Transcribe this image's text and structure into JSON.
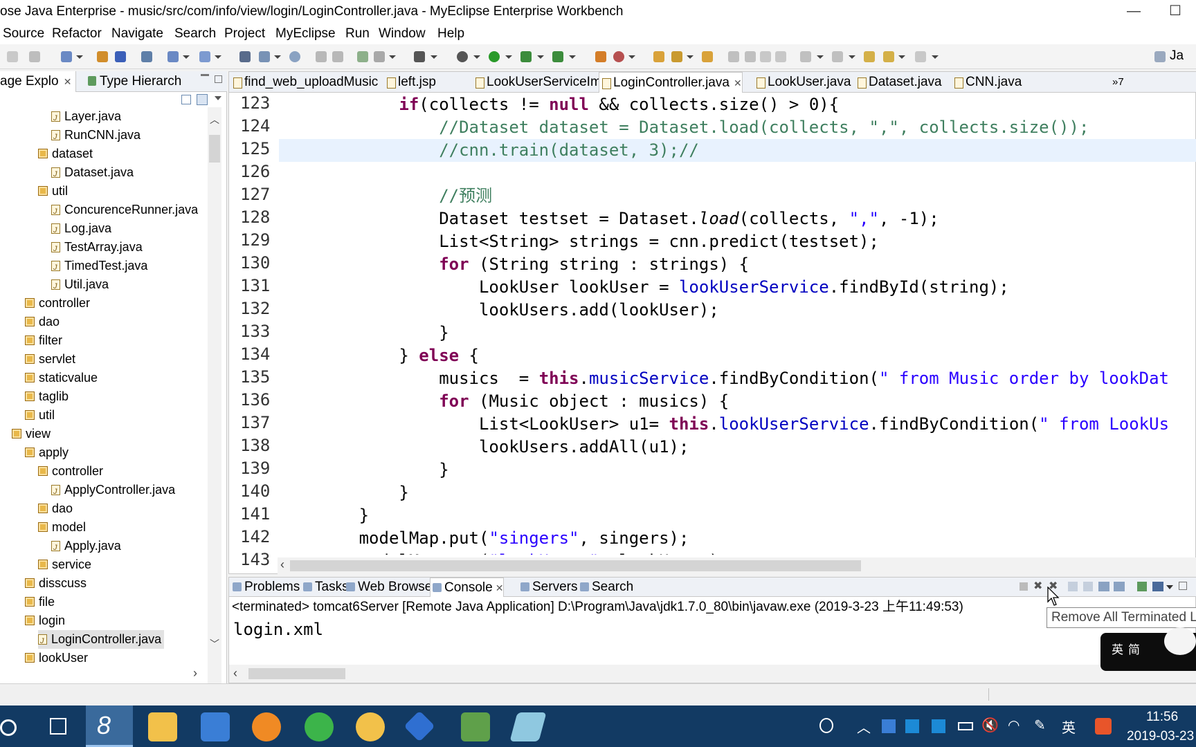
{
  "window": {
    "title": "ose Java Enterprise - music/src/com/info/view/login/LoginController.java - MyEclipse Enterprise Workbench",
    "minimize": "—",
    "maximize": "☐"
  },
  "menu": [
    "Source",
    "Refactor",
    "Navigate",
    "Search",
    "Project",
    "MyEclipse",
    "Run",
    "Window",
    "Help"
  ],
  "toolbar": {
    "perspective": "Ja"
  },
  "left_panel": {
    "tabs": [
      {
        "label": "age Explo",
        "close": "✕"
      },
      {
        "label": "Type Hierarch"
      }
    ],
    "tree": [
      {
        "label": "Layer.java",
        "type": "java",
        "indent": 4
      },
      {
        "label": "RunCNN.java",
        "type": "java",
        "indent": 4
      },
      {
        "label": "dataset",
        "type": "pkg",
        "indent": 3
      },
      {
        "label": "Dataset.java",
        "type": "java",
        "indent": 4
      },
      {
        "label": "util",
        "type": "pkg",
        "indent": 3
      },
      {
        "label": "ConcurenceRunner.java",
        "type": "java",
        "indent": 4
      },
      {
        "label": "Log.java",
        "type": "java",
        "indent": 4
      },
      {
        "label": "TestArray.java",
        "type": "java",
        "indent": 4
      },
      {
        "label": "TimedTest.java",
        "type": "java",
        "indent": 4
      },
      {
        "label": "Util.java",
        "type": "java",
        "indent": 4
      },
      {
        "label": "controller",
        "type": "pkg",
        "indent": 2
      },
      {
        "label": "dao",
        "type": "pkg",
        "indent": 2
      },
      {
        "label": "filter",
        "type": "pkg",
        "indent": 2
      },
      {
        "label": "servlet",
        "type": "pkg",
        "indent": 2
      },
      {
        "label": "staticvalue",
        "type": "pkg",
        "indent": 2
      },
      {
        "label": "taglib",
        "type": "pkg",
        "indent": 2
      },
      {
        "label": "util",
        "type": "pkg",
        "indent": 2
      },
      {
        "label": "view",
        "type": "pkg",
        "indent": 1
      },
      {
        "label": "apply",
        "type": "pkg",
        "indent": 2
      },
      {
        "label": "controller",
        "type": "pkg",
        "indent": 3
      },
      {
        "label": "ApplyController.java",
        "type": "java",
        "indent": 4
      },
      {
        "label": "dao",
        "type": "pkg",
        "indent": 3
      },
      {
        "label": "model",
        "type": "pkg",
        "indent": 3
      },
      {
        "label": "Apply.java",
        "type": "java",
        "indent": 4
      },
      {
        "label": "service",
        "type": "pkg",
        "indent": 3
      },
      {
        "label": "disscuss",
        "type": "pkg",
        "indent": 2
      },
      {
        "label": "file",
        "type": "pkg",
        "indent": 2
      },
      {
        "label": "login",
        "type": "pkg",
        "indent": 2
      },
      {
        "label": "LoginController.java",
        "type": "java",
        "indent": 3,
        "selected": true
      },
      {
        "label": "lookUser",
        "type": "pkg",
        "indent": 2
      }
    ]
  },
  "editor": {
    "tabs": [
      {
        "label": "find_web_uploadMusic"
      },
      {
        "label": "left.jsp"
      },
      {
        "label": "LookUserServiceImpl."
      },
      {
        "label": "LoginController.java",
        "close": "✕",
        "active": true
      },
      {
        "label": "LookUser.java"
      },
      {
        "label": "Dataset.java"
      },
      {
        "label": "CNN.java"
      }
    ],
    "overflow": "»7",
    "current_line": "125",
    "lines": [
      {
        "n": "123",
        "t": [
          [
            "            ",
            ""
          ],
          [
            "if",
            "kw"
          ],
          [
            "(collects != ",
            ""
          ],
          [
            "null",
            "kw"
          ],
          [
            " && collects.size() > 0){",
            ""
          ]
        ]
      },
      {
        "n": "124",
        "t": [
          [
            "                ",
            ""
          ],
          [
            "//Dataset dataset = Dataset.load(collects, \",\", collects.size());",
            "cm"
          ]
        ]
      },
      {
        "n": "125",
        "t": [
          [
            "                ",
            ""
          ],
          [
            "//cnn.train(dataset, 3);//",
            "cm"
          ]
        ]
      },
      {
        "n": "126",
        "t": [
          [
            "",
            ""
          ]
        ]
      },
      {
        "n": "127",
        "t": [
          [
            "                ",
            ""
          ],
          [
            "//预测",
            "cm"
          ]
        ]
      },
      {
        "n": "128",
        "t": [
          [
            "                Dataset testset = Dataset.",
            ""
          ],
          [
            "load",
            "it"
          ],
          [
            "(collects, ",
            ""
          ],
          [
            "\",\"",
            "st"
          ],
          [
            ", -1);",
            ""
          ]
        ]
      },
      {
        "n": "129",
        "t": [
          [
            "                List<String> strings = cnn.predict(testset);",
            ""
          ]
        ]
      },
      {
        "n": "130",
        "t": [
          [
            "                ",
            ""
          ],
          [
            "for",
            "kw"
          ],
          [
            " (String string : strings) {",
            ""
          ]
        ]
      },
      {
        "n": "131",
        "t": [
          [
            "                    LookUser lookUser = ",
            ""
          ],
          [
            "lookUserService",
            "fd"
          ],
          [
            ".findById(string);",
            ""
          ]
        ]
      },
      {
        "n": "132",
        "t": [
          [
            "                    lookUsers.add(lookUser);",
            ""
          ]
        ]
      },
      {
        "n": "133",
        "t": [
          [
            "                }",
            ""
          ]
        ]
      },
      {
        "n": "134",
        "t": [
          [
            "            } ",
            ""
          ],
          [
            "else",
            "kw"
          ],
          [
            " {",
            ""
          ]
        ]
      },
      {
        "n": "135",
        "t": [
          [
            "                musics  = ",
            ""
          ],
          [
            "this",
            "kw"
          ],
          [
            ".",
            ""
          ],
          [
            "musicService",
            "fd"
          ],
          [
            ".findByCondition(",
            ""
          ],
          [
            "\" from Music order by lookDat",
            "st"
          ]
        ]
      },
      {
        "n": "136",
        "t": [
          [
            "                ",
            ""
          ],
          [
            "for",
            "kw"
          ],
          [
            " (Music object : musics) {",
            ""
          ]
        ]
      },
      {
        "n": "137",
        "t": [
          [
            "                    List<LookUser> u1= ",
            ""
          ],
          [
            "this",
            "kw"
          ],
          [
            ".",
            ""
          ],
          [
            "lookUserService",
            "fd"
          ],
          [
            ".findByCondition(",
            ""
          ],
          [
            "\" from LookUs",
            "st"
          ]
        ]
      },
      {
        "n": "138",
        "t": [
          [
            "                    lookUsers.addAll(u1);",
            ""
          ]
        ]
      },
      {
        "n": "139",
        "t": [
          [
            "                }",
            ""
          ]
        ]
      },
      {
        "n": "140",
        "t": [
          [
            "            }",
            ""
          ]
        ]
      },
      {
        "n": "141",
        "t": [
          [
            "        }",
            ""
          ]
        ]
      },
      {
        "n": "142",
        "t": [
          [
            "        modelMap.put(",
            ""
          ],
          [
            "\"singers\"",
            "st"
          ],
          [
            ", singers);",
            ""
          ]
        ]
      },
      {
        "n": "143",
        "t": [
          [
            "        modelMap.put(",
            ""
          ],
          [
            "\"lookUsers\"",
            "st"
          ],
          [
            ", lookUsers);",
            ""
          ]
        ]
      }
    ]
  },
  "console": {
    "tabs": [
      {
        "label": "Problems"
      },
      {
        "label": "Tasks"
      },
      {
        "label": "Web Browser"
      },
      {
        "label": "Console",
        "close": "✕",
        "active": true
      },
      {
        "label": "Servers"
      },
      {
        "label": "Search"
      }
    ],
    "info": "<terminated> tomcat6Server [Remote Java Application] D:\\Program\\Java\\jdk1.7.0_80\\bin\\javaw.exe (2019-3-23 上午11:49:53)",
    "output": "login.xml",
    "tooltip": "Remove All Terminated L"
  },
  "ime": {
    "text1": "英",
    "text2": "简"
  },
  "taskbar": {
    "time": "11:56",
    "date": "2019-03-23",
    "lang": "英"
  },
  "colors": {
    "keyword": "#7f0055",
    "comment": "#3f7f5f",
    "string": "#2a00ff",
    "field": "#0000c0",
    "taskbar": "#123a63"
  }
}
